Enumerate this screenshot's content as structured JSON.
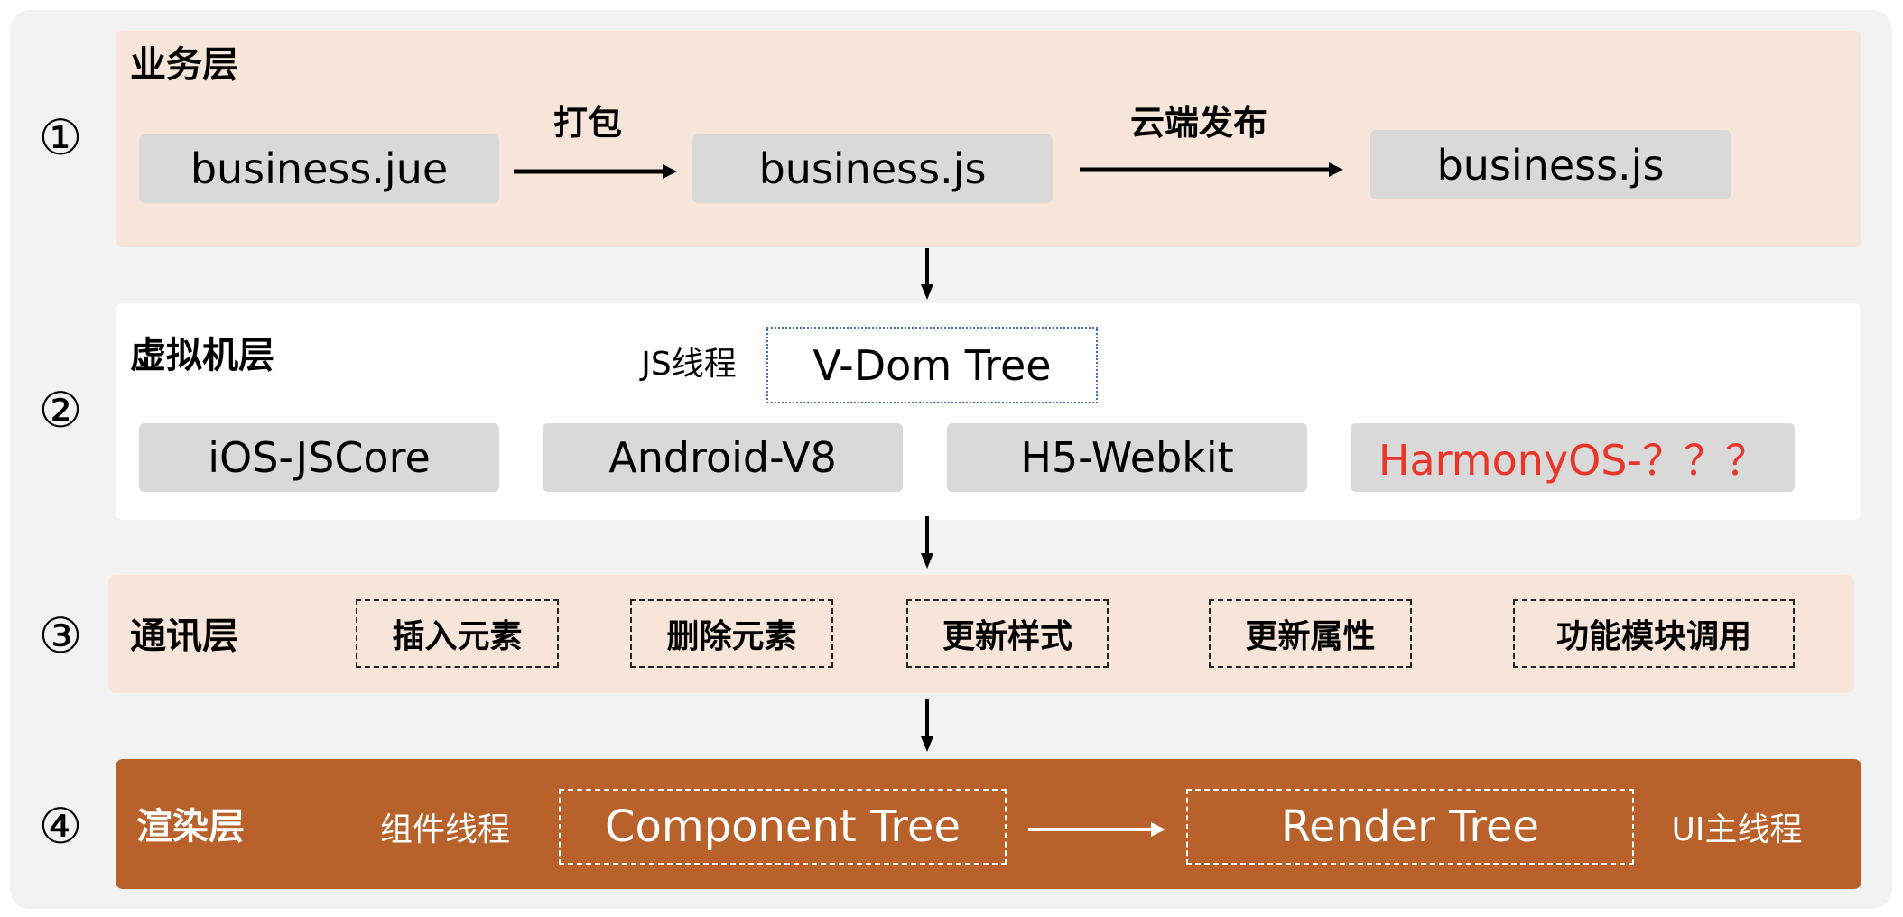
{
  "layers": [
    {
      "number": "①",
      "title": "业务层",
      "items": [
        "business.jue",
        "business.js",
        "business.js"
      ],
      "arrows": [
        "打包",
        "云端发布"
      ]
    },
    {
      "number": "②",
      "title": "虚拟机层",
      "thread_label": "JS线程",
      "tree": "V-Dom Tree",
      "engines": [
        "iOS-JSCore",
        "Android-V8",
        "H5-Webkit",
        "HarmonyOS-？？？"
      ]
    },
    {
      "number": "③",
      "title": "通讯层",
      "operations": [
        "插入元素",
        "删除元素",
        "更新样式",
        "更新属性",
        "功能模块调用"
      ]
    },
    {
      "number": "④",
      "title": "渲染层",
      "component_thread_label": "组件线程",
      "component_tree": "Component Tree",
      "render_tree": "Render Tree",
      "ui_thread_label": "UI主线程"
    }
  ],
  "colors": {
    "layer_beige": "#f7e5d9",
    "layer_render": "#b8612b",
    "engine_box": "#d9d9d9",
    "highlight_red": "#e8362a",
    "vdom_border": "#4a6fc4",
    "panel_bg": "#f2f2f2"
  }
}
